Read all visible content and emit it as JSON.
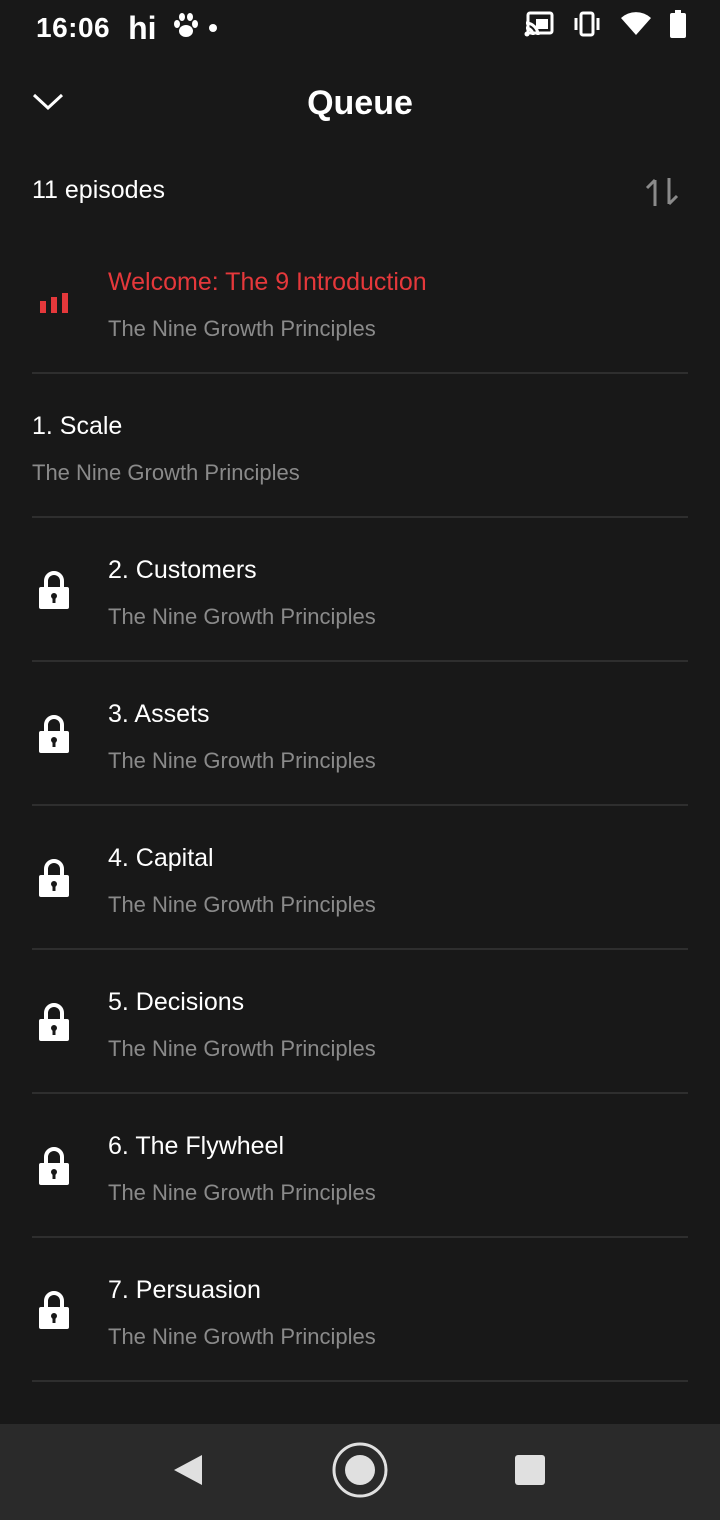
{
  "status_bar": {
    "time": "16:06",
    "carrier": "hi",
    "icons": [
      "paw-icon",
      "dot-icon",
      "cast-icon",
      "vibrate-icon",
      "wifi-icon",
      "battery-icon"
    ]
  },
  "header": {
    "title": "Queue",
    "collapse_icon": "chevron-down-icon"
  },
  "queue": {
    "count_label": "11 episodes",
    "sort_icon": "sort-icon",
    "episodes": [
      {
        "title": "Welcome: The 9 Introduction",
        "subtitle": "The Nine Growth Principles",
        "state": "playing",
        "icon": "equalizer-icon"
      },
      {
        "title": "1. Scale",
        "subtitle": "The Nine Growth Principles",
        "state": "unlocked",
        "icon": ""
      },
      {
        "title": "2. Customers",
        "subtitle": "The Nine Growth Principles",
        "state": "locked",
        "icon": "lock-icon"
      },
      {
        "title": "3. Assets",
        "subtitle": "The Nine Growth Principles",
        "state": "locked",
        "icon": "lock-icon"
      },
      {
        "title": "4. Capital",
        "subtitle": "The Nine Growth Principles",
        "state": "locked",
        "icon": "lock-icon"
      },
      {
        "title": "5. Decisions",
        "subtitle": "The Nine Growth Principles",
        "state": "locked",
        "icon": "lock-icon"
      },
      {
        "title": "6. The Flywheel",
        "subtitle": "The Nine Growth Principles",
        "state": "locked",
        "icon": "lock-icon"
      },
      {
        "title": "7. Persuasion",
        "subtitle": "The Nine Growth Principles",
        "state": "locked",
        "icon": "lock-icon"
      }
    ]
  },
  "nav_bar": {
    "icons": [
      "back-icon",
      "home-icon",
      "recents-icon"
    ]
  },
  "colors": {
    "background": "#181818",
    "accent": "#e5383b",
    "subtitle": "#8a8a8a",
    "navbar": "#2a2a2a"
  }
}
